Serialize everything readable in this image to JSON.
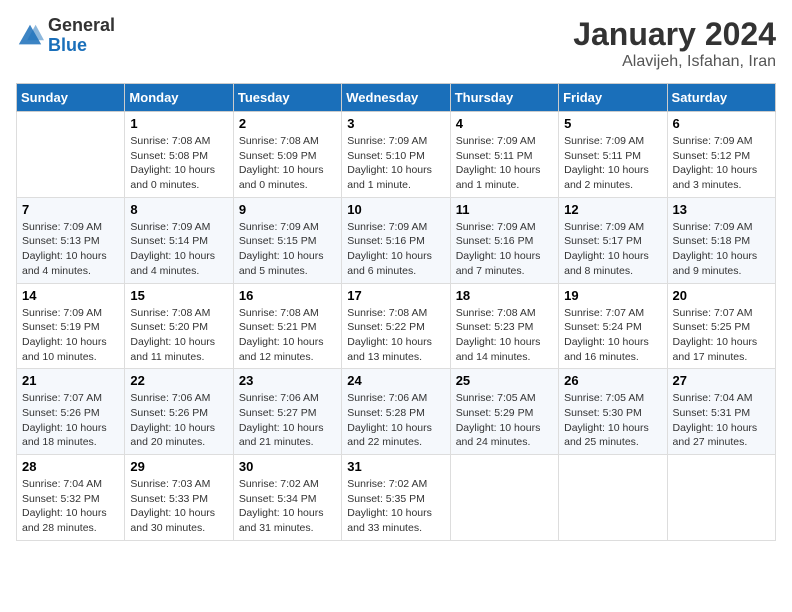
{
  "header": {
    "logo_general": "General",
    "logo_blue": "Blue",
    "month_year": "January 2024",
    "location": "Alavijeh, Isfahan, Iran"
  },
  "days_of_week": [
    "Sunday",
    "Monday",
    "Tuesday",
    "Wednesday",
    "Thursday",
    "Friday",
    "Saturday"
  ],
  "weeks": [
    [
      {
        "day": "",
        "info": ""
      },
      {
        "day": "1",
        "info": "Sunrise: 7:08 AM\nSunset: 5:08 PM\nDaylight: 10 hours\nand 0 minutes."
      },
      {
        "day": "2",
        "info": "Sunrise: 7:08 AM\nSunset: 5:09 PM\nDaylight: 10 hours\nand 0 minutes."
      },
      {
        "day": "3",
        "info": "Sunrise: 7:09 AM\nSunset: 5:10 PM\nDaylight: 10 hours\nand 1 minute."
      },
      {
        "day": "4",
        "info": "Sunrise: 7:09 AM\nSunset: 5:11 PM\nDaylight: 10 hours\nand 1 minute."
      },
      {
        "day": "5",
        "info": "Sunrise: 7:09 AM\nSunset: 5:11 PM\nDaylight: 10 hours\nand 2 minutes."
      },
      {
        "day": "6",
        "info": "Sunrise: 7:09 AM\nSunset: 5:12 PM\nDaylight: 10 hours\nand 3 minutes."
      }
    ],
    [
      {
        "day": "7",
        "info": "Sunrise: 7:09 AM\nSunset: 5:13 PM\nDaylight: 10 hours\nand 4 minutes."
      },
      {
        "day": "8",
        "info": "Sunrise: 7:09 AM\nSunset: 5:14 PM\nDaylight: 10 hours\nand 4 minutes."
      },
      {
        "day": "9",
        "info": "Sunrise: 7:09 AM\nSunset: 5:15 PM\nDaylight: 10 hours\nand 5 minutes."
      },
      {
        "day": "10",
        "info": "Sunrise: 7:09 AM\nSunset: 5:16 PM\nDaylight: 10 hours\nand 6 minutes."
      },
      {
        "day": "11",
        "info": "Sunrise: 7:09 AM\nSunset: 5:16 PM\nDaylight: 10 hours\nand 7 minutes."
      },
      {
        "day": "12",
        "info": "Sunrise: 7:09 AM\nSunset: 5:17 PM\nDaylight: 10 hours\nand 8 minutes."
      },
      {
        "day": "13",
        "info": "Sunrise: 7:09 AM\nSunset: 5:18 PM\nDaylight: 10 hours\nand 9 minutes."
      }
    ],
    [
      {
        "day": "14",
        "info": "Sunrise: 7:09 AM\nSunset: 5:19 PM\nDaylight: 10 hours\nand 10 minutes."
      },
      {
        "day": "15",
        "info": "Sunrise: 7:08 AM\nSunset: 5:20 PM\nDaylight: 10 hours\nand 11 minutes."
      },
      {
        "day": "16",
        "info": "Sunrise: 7:08 AM\nSunset: 5:21 PM\nDaylight: 10 hours\nand 12 minutes."
      },
      {
        "day": "17",
        "info": "Sunrise: 7:08 AM\nSunset: 5:22 PM\nDaylight: 10 hours\nand 13 minutes."
      },
      {
        "day": "18",
        "info": "Sunrise: 7:08 AM\nSunset: 5:23 PM\nDaylight: 10 hours\nand 14 minutes."
      },
      {
        "day": "19",
        "info": "Sunrise: 7:07 AM\nSunset: 5:24 PM\nDaylight: 10 hours\nand 16 minutes."
      },
      {
        "day": "20",
        "info": "Sunrise: 7:07 AM\nSunset: 5:25 PM\nDaylight: 10 hours\nand 17 minutes."
      }
    ],
    [
      {
        "day": "21",
        "info": "Sunrise: 7:07 AM\nSunset: 5:26 PM\nDaylight: 10 hours\nand 18 minutes."
      },
      {
        "day": "22",
        "info": "Sunrise: 7:06 AM\nSunset: 5:26 PM\nDaylight: 10 hours\nand 20 minutes."
      },
      {
        "day": "23",
        "info": "Sunrise: 7:06 AM\nSunset: 5:27 PM\nDaylight: 10 hours\nand 21 minutes."
      },
      {
        "day": "24",
        "info": "Sunrise: 7:06 AM\nSunset: 5:28 PM\nDaylight: 10 hours\nand 22 minutes."
      },
      {
        "day": "25",
        "info": "Sunrise: 7:05 AM\nSunset: 5:29 PM\nDaylight: 10 hours\nand 24 minutes."
      },
      {
        "day": "26",
        "info": "Sunrise: 7:05 AM\nSunset: 5:30 PM\nDaylight: 10 hours\nand 25 minutes."
      },
      {
        "day": "27",
        "info": "Sunrise: 7:04 AM\nSunset: 5:31 PM\nDaylight: 10 hours\nand 27 minutes."
      }
    ],
    [
      {
        "day": "28",
        "info": "Sunrise: 7:04 AM\nSunset: 5:32 PM\nDaylight: 10 hours\nand 28 minutes."
      },
      {
        "day": "29",
        "info": "Sunrise: 7:03 AM\nSunset: 5:33 PM\nDaylight: 10 hours\nand 30 minutes."
      },
      {
        "day": "30",
        "info": "Sunrise: 7:02 AM\nSunset: 5:34 PM\nDaylight: 10 hours\nand 31 minutes."
      },
      {
        "day": "31",
        "info": "Sunrise: 7:02 AM\nSunset: 5:35 PM\nDaylight: 10 hours\nand 33 minutes."
      },
      {
        "day": "",
        "info": ""
      },
      {
        "day": "",
        "info": ""
      },
      {
        "day": "",
        "info": ""
      }
    ]
  ]
}
